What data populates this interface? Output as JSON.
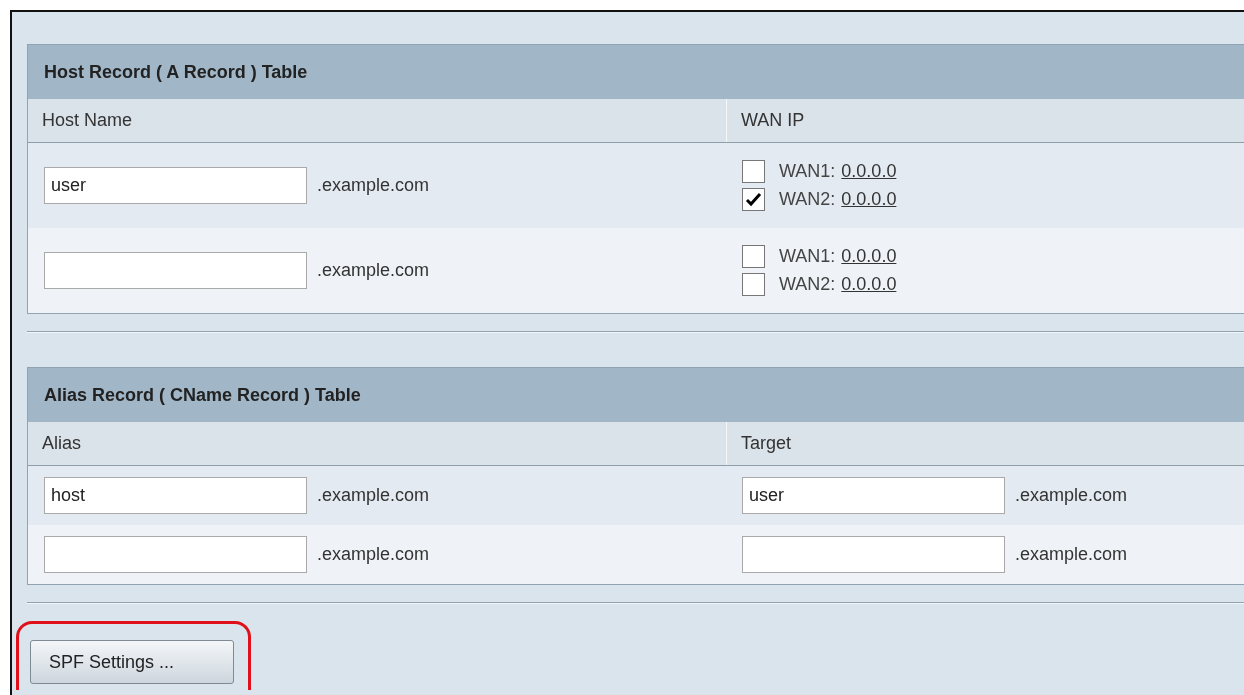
{
  "tables": [
    {
      "title": "Host Record ( A Record ) Table",
      "columns": [
        "Host Name",
        "WAN IP"
      ],
      "rows": [
        {
          "cells": [
            {
              "kind": "domain",
              "value": "user",
              "suffix": ".example.com"
            },
            {
              "kind": "wan",
              "options": [
                {
                  "label": "WAN1:",
                  "ip": "0.0.0.0",
                  "checked": false
                },
                {
                  "label": "WAN2:",
                  "ip": "0.0.0.0",
                  "checked": true
                }
              ]
            }
          ]
        },
        {
          "cells": [
            {
              "kind": "domain",
              "suffix": ".example.com"
            },
            {
              "kind": "wan",
              "options": [
                {
                  "label": "WAN1:",
                  "ip": "0.0.0.0",
                  "checked": false
                },
                {
                  "label": "WAN2:",
                  "ip": "0.0.0.0",
                  "checked": false
                }
              ]
            }
          ]
        }
      ]
    },
    {
      "title": "Alias Record ( CName Record ) Table",
      "columns": [
        "Alias",
        "Target"
      ],
      "rows": [
        {
          "cells": [
            {
              "kind": "domain",
              "value": "host",
              "suffix": ".example.com"
            },
            {
              "kind": "domain",
              "value": "user",
              "suffix": ".example.com"
            }
          ]
        },
        {
          "cells": [
            {
              "kind": "domain",
              "suffix": ".example.com"
            },
            {
              "kind": "domain",
              "suffix": ".example.com"
            }
          ]
        }
      ]
    }
  ],
  "button": {
    "label": "SPF Settings ...",
    "highlighted": true
  }
}
